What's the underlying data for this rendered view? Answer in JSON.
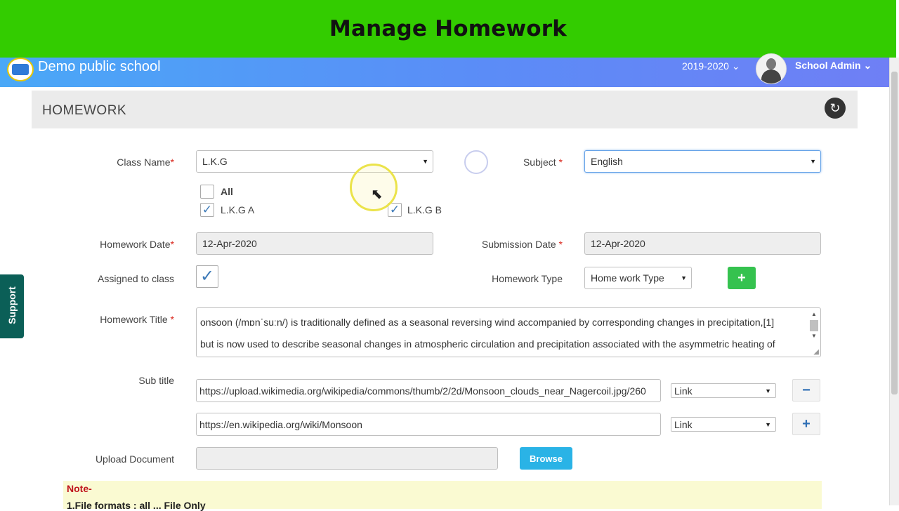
{
  "banner": {
    "title": "Manage Homework"
  },
  "appbar": {
    "school_name": "Demo public school",
    "year": "2019-2020 ⌄",
    "user": "School Admin ⌄"
  },
  "panel": {
    "title": "HOMEWORK"
  },
  "form": {
    "class_label": "Class Name",
    "class_value": "L.K.G",
    "subject_label": "Subject",
    "subject_value": "English",
    "sections": [
      {
        "label": "All",
        "checked": false
      },
      {
        "label": "L.K.G A",
        "checked": true
      },
      {
        "label": "L.K.G B",
        "checked": true
      }
    ],
    "homework_date_label": "Homework Date",
    "homework_date_value": "12-Apr-2020",
    "submission_date_label": "Submission Date",
    "submission_date_value": "12-Apr-2020",
    "assigned_label": "Assigned to class",
    "assigned_checked": true,
    "type_label": "Homework Type",
    "type_value": "Home work Type",
    "title_label": "Homework Title",
    "title_line1": "onsoon (/mɒnˈsuːn/) is traditionally defined as a seasonal reversing wind accompanied by corresponding changes in precipitation,[1]",
    "title_line2": "but is now used to describe seasonal changes in atmospheric circulation and precipitation associated with the asymmetric heating of",
    "subtitle_label": "Sub title",
    "subtitle_rows": [
      {
        "url": "https://upload.wikimedia.org/wikipedia/commons/thumb/2/2d/Monsoon_clouds_near_Nagercoil.jpg/260",
        "kind": "Link",
        "action": "−"
      },
      {
        "url": "https://en.wikipedia.org/wiki/Monsoon",
        "kind": "Link",
        "action": "+"
      }
    ],
    "upload_label": "Upload Document",
    "browse_label": "Browse",
    "add_label": "+",
    "required_mark": "*"
  },
  "support_label": "Support",
  "note": {
    "title": "Note-",
    "line1": "1.File formats : all ... File Only"
  },
  "icons": {
    "back": "back-icon",
    "check": "check-icon",
    "caret": "caret-down-icon"
  },
  "colors": {
    "banner": "#33cc00",
    "appbar": "#5b8cf7",
    "add": "#35c24f",
    "browse": "#2ab3e6",
    "support": "#0b5f57"
  }
}
